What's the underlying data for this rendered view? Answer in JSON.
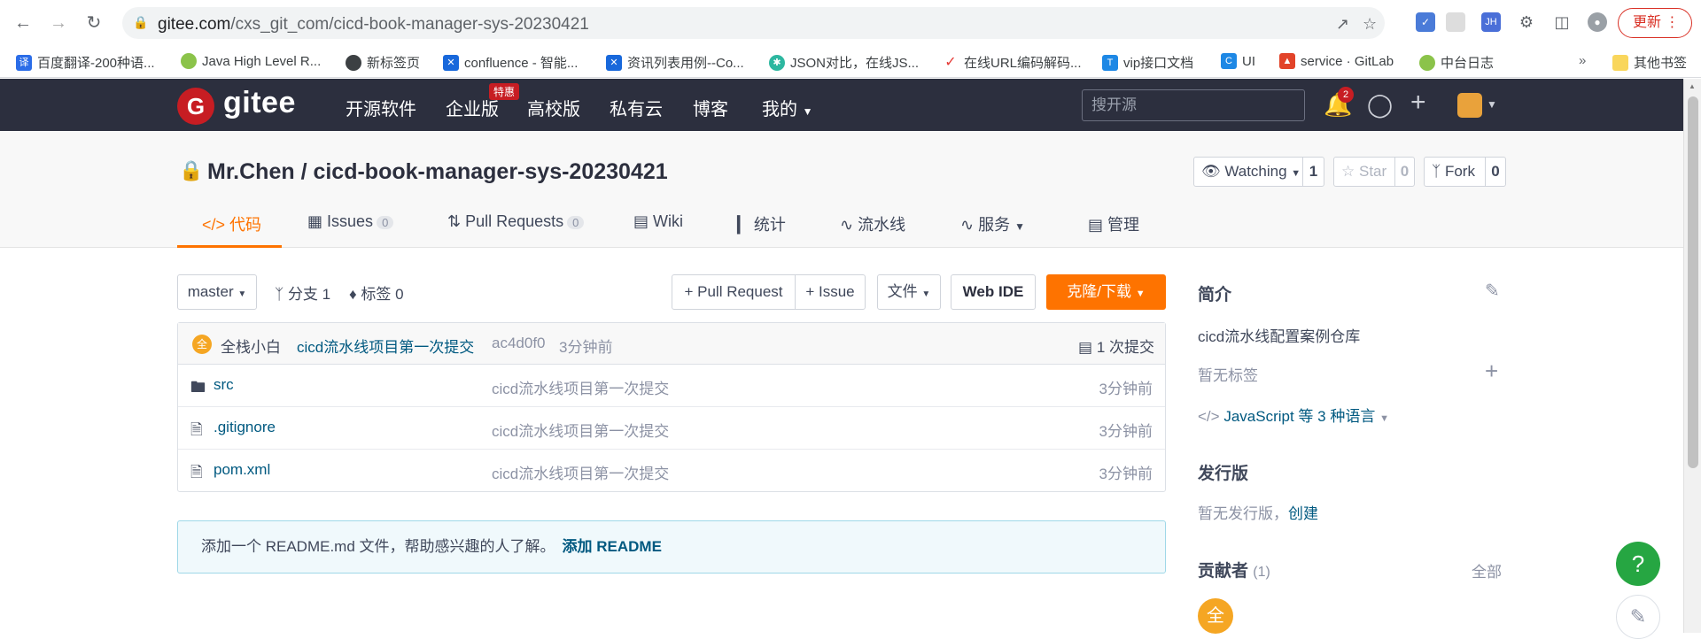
{
  "browser": {
    "url_host": "gitee.com",
    "url_path": "/cxs_git_com/cicd-book-manager-sys-20230421",
    "update_label": "更新",
    "bookmarks": [
      "百度翻译-200种语...",
      "Java High Level R...",
      "新标签页",
      "confluence - 智能...",
      "资讯列表用例--Co...",
      "JSON对比，在线JS...",
      "在线URL编码解码...",
      "vip接口文档",
      "UI",
      "service · GitLab",
      "中台日志",
      "其他书签"
    ]
  },
  "header": {
    "logo": "gitee",
    "nav": [
      "开源软件",
      "企业版",
      "高校版",
      "私有云",
      "博客",
      "我的"
    ],
    "special_badge": "特惠",
    "search_placeholder": "搜开源",
    "notif_count": "2"
  },
  "repo": {
    "title": "Mr.Chen / cicd-book-manager-sys-20230421",
    "watching_label": "Watching",
    "watching_count": "1",
    "star_label": "Star",
    "star_count": "0",
    "fork_label": "Fork",
    "fork_count": "0",
    "tabs": [
      {
        "label": "代码"
      },
      {
        "label": "Issues",
        "count": "0"
      },
      {
        "label": "Pull Requests",
        "count": "0"
      },
      {
        "label": "Wiki"
      },
      {
        "label": "统计"
      },
      {
        "label": "流水线"
      },
      {
        "label": "服务"
      },
      {
        "label": "管理"
      }
    ]
  },
  "toolbar": {
    "branch": "master",
    "branches": "分支 1",
    "tags": "标签 0",
    "pull_request": "+ Pull Request",
    "issue": "+ Issue",
    "file": "文件",
    "webide": "Web IDE",
    "clone": "克隆/下载"
  },
  "commit": {
    "avatar": "全",
    "author": "全栈小白",
    "message": "cicd流水线项目第一次提交",
    "hash": "ac4d0f0",
    "time": "3分钟前",
    "total": "1 次提交"
  },
  "files": [
    {
      "name": "src",
      "message": "cicd流水线项目第一次提交",
      "time": "3分钟前"
    },
    {
      "name": ".gitignore",
      "message": "cicd流水线项目第一次提交",
      "time": "3分钟前"
    },
    {
      "name": "pom.xml",
      "message": "cicd流水线项目第一次提交",
      "time": "3分钟前"
    }
  ],
  "readme_notice": {
    "text": "添加一个 README.md 文件，帮助感兴趣的人了解。",
    "link": "添加 README"
  },
  "sidebar": {
    "intro_title": "简介",
    "intro_text": "cicd流水线配置案例仓库",
    "no_tags": "暂无标签",
    "languages": "JavaScript 等 3 种语言",
    "release_title": "发行版",
    "no_release": "暂无发行版，",
    "create": "创建",
    "contrib_title": "贡献者",
    "contrib_count": "(1)",
    "all": "全部",
    "contrib_avatar": "全"
  },
  "float": {
    "help": "?"
  }
}
